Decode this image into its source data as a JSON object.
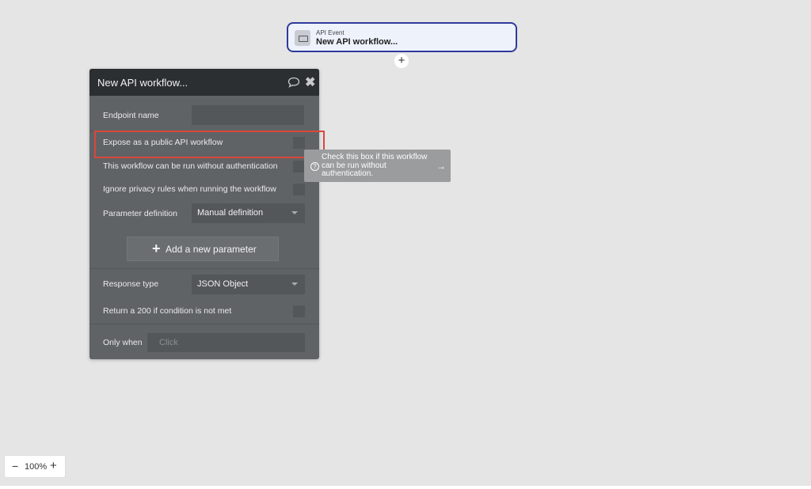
{
  "event": {
    "type_label": "API Event",
    "name": "New API workflow...",
    "icon": "api-event-icon"
  },
  "add_step_label": "+",
  "panel": {
    "title": "New API workflow...",
    "comment_icon": "comment-icon",
    "close_icon": "close-icon",
    "close_glyph": "✖",
    "fields": {
      "endpoint_name_label": "Endpoint name",
      "endpoint_name_value": "",
      "expose_label": "Expose as a public API workflow",
      "no_auth_label": "This workflow can be run without authentication",
      "ignore_privacy_label": "Ignore privacy rules when running the workflow",
      "parameter_definition_label": "Parameter definition",
      "parameter_definition_value": "Manual definition",
      "add_parameter_plus": "+",
      "add_parameter_label": "Add a new parameter",
      "response_type_label": "Response type",
      "response_type_value": "JSON Object",
      "return_200_label": "Return a 200 if condition is not met",
      "only_when_label": "Only when",
      "only_when_placeholder": "Click"
    },
    "checkboxes": {
      "expose": false,
      "no_auth": false,
      "ignore_privacy": false,
      "return_200": false
    }
  },
  "tooltip": {
    "question_glyph": "?",
    "text": "Check this box if this workflow can be run without authentication.",
    "arrow": "→"
  },
  "zoom": {
    "minus": "−",
    "value": "100%",
    "plus": "+"
  },
  "colors": {
    "canvas": "#e5e5e5",
    "panel": "#606366",
    "panel_header": "#2b2f31",
    "event_border": "#2e3a9c",
    "highlight": "#d9473a"
  }
}
